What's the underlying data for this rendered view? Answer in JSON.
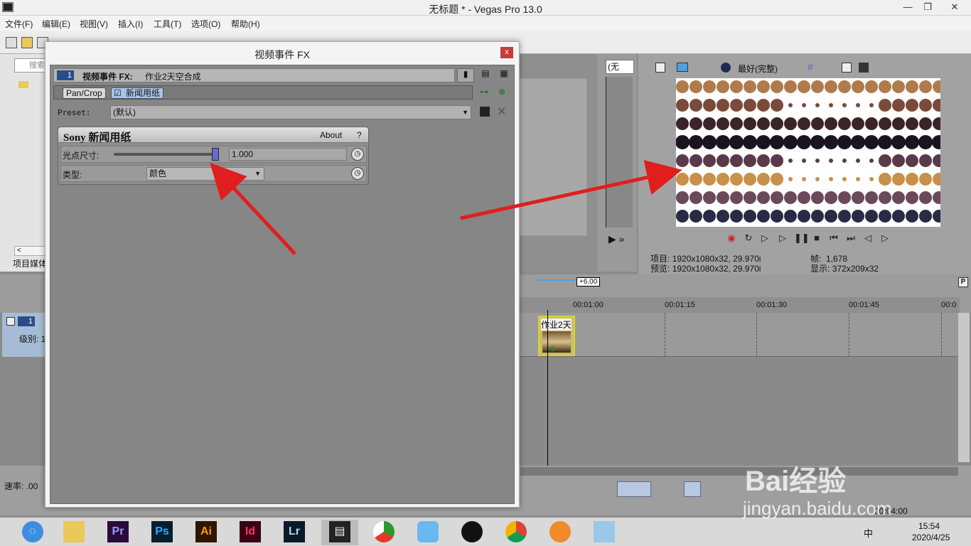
{
  "window": {
    "title": "无标题 * - Vegas Pro 13.0"
  },
  "menu": [
    "文件(F)",
    "编辑(E)",
    "视图(V)",
    "插入(I)",
    "工具(T)",
    "选项(O)",
    "帮助(H)"
  ],
  "explorer": {
    "search_placeholder": "搜索",
    "tab_label": "项目媒体"
  },
  "trimmer": {
    "dropdown": "(无"
  },
  "preview": {
    "quality": "最好(完整)",
    "project_label": "项目:",
    "project_value": "1920x1080x32, 29.970i",
    "preview_label": "预览:",
    "preview_value": "1920x1080x32, 29.970i",
    "frame_label": "帧:",
    "frame_value": "1,678",
    "display_label": "显示:",
    "display_value": "372x209x32"
  },
  "timeline": {
    "ruler": [
      "00:01:00",
      "00:01:15",
      "00:01:30",
      "00:01:45",
      "00:0"
    ],
    "speed_marker": "+6.00",
    "track_number": "1",
    "track_level": "级别: 1",
    "clip_label": "作业2天",
    "rate_label": "速率: .00",
    "bottom_time": "00:04:00"
  },
  "dialog": {
    "title": "视频事件 FX",
    "close": "x",
    "chain_number": "1",
    "chain_title": "视频事件 FX:",
    "chain_event": "作业2天空合成",
    "plugins": [
      "Pan/Crop",
      "新闻用纸"
    ],
    "preset_label": "Preset:",
    "preset_value": "(默认)",
    "fx_title": "Sony 新闻用纸",
    "about": "About",
    "help": "?",
    "dot_size_label": "光点尺寸:",
    "dot_size_value": "1.000",
    "dot_size_level": 1.0,
    "type_label": "类型:",
    "type_value": "颜色"
  },
  "taskbar": {
    "apps": [
      "Pr",
      "Ps",
      "Ai",
      "Id",
      "Lr"
    ],
    "time": "15:54",
    "date": "2020/4/25",
    "ime": "中"
  },
  "watermark": {
    "brand": "Bai经验",
    "url": "jingyan.baidu.com"
  },
  "colors": {
    "pr": "#9999ff",
    "ps": "#31a8ff",
    "ai": "#ff9a00",
    "id": "#ff3366",
    "lr": "#add5ec",
    "arrow": "#e01e1e",
    "close": "#c83b3b"
  }
}
